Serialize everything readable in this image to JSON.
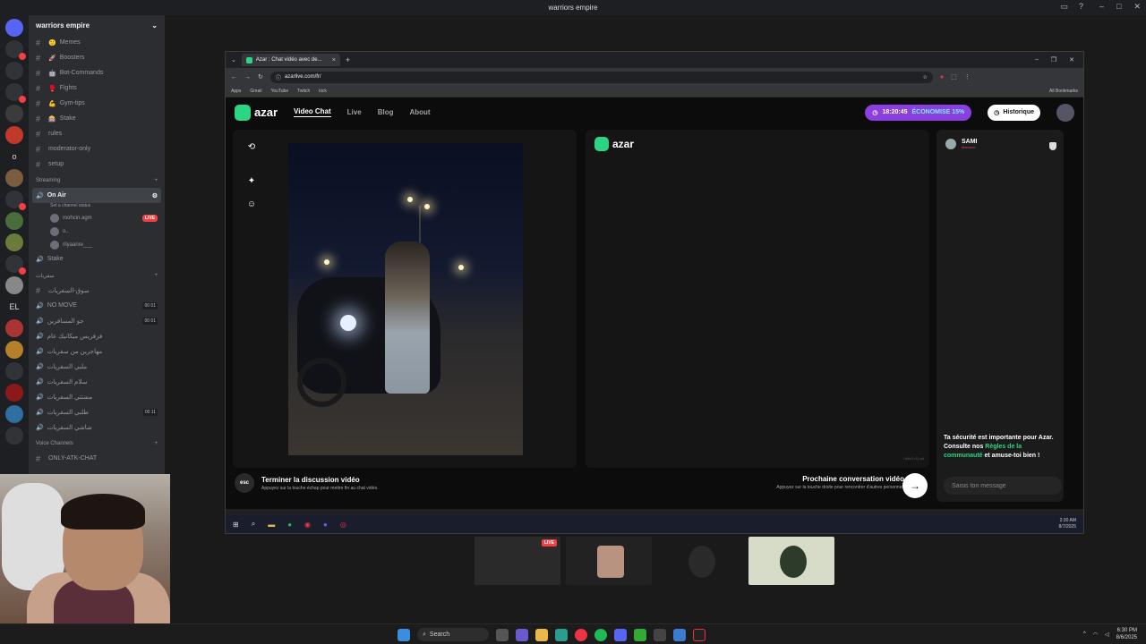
{
  "discord": {
    "window_title": "warriors empire",
    "server_name": "warriors empire",
    "channels": [
      {
        "name": "Memes",
        "emoji": "🙂"
      },
      {
        "name": "Boosters",
        "emoji": "🚀"
      },
      {
        "name": "Bot-Commands",
        "emoji": "🤖"
      },
      {
        "name": "Fights",
        "emoji": "🥊"
      },
      {
        "name": "Gym-tips",
        "emoji": "💪"
      },
      {
        "name": "Stake",
        "emoji": "🎰"
      },
      {
        "name": "rules",
        "emoji": ""
      },
      {
        "name": "moderator-only",
        "emoji": ""
      },
      {
        "name": "setup",
        "emoji": ""
      }
    ],
    "streaming_category": "Streaming",
    "on_air": "On Air",
    "on_air_status": "Set a channel status",
    "on_air_users": [
      {
        "name": "mohcin.agm",
        "live": "LIVE"
      },
      {
        "name": "o..",
        "live": ""
      },
      {
        "name": "rilyaanre___",
        "live": ""
      }
    ],
    "stake_voice": "Stake",
    "arabic_category": "سفريات",
    "arabic_channels": [
      {
        "name": "سوق-السفريات",
        "count": ""
      },
      {
        "name": "NO MOVE",
        "count": "00 01"
      },
      {
        "name": "جو المسافرين",
        "count": "00 01"
      },
      {
        "name": "فرفريس ميكانيك عام",
        "count": ""
      },
      {
        "name": "مهاجرين من سفريات",
        "count": ""
      },
      {
        "name": "ملبي السفريات",
        "count": ""
      },
      {
        "name": "سلام السفريات",
        "count": ""
      },
      {
        "name": "مشتتي السفريات",
        "count": ""
      },
      {
        "name": "طلبي السفريات",
        "count": "00 11"
      },
      {
        "name": "شاشي السفريات",
        "count": ""
      }
    ],
    "voice_category": "Voice Channels",
    "voice_channel": "ONLY-ATK-CHAT"
  },
  "browser": {
    "tab_title": "Azar : Chat vidéo avec de...",
    "url": "azarlive.com/fr/",
    "bookmarks": [
      "Apps",
      "Gmail",
      "YouTube",
      "Twitch",
      "kick"
    ],
    "all_bookmarks": "All Bookmarks"
  },
  "azar": {
    "logo": "azar",
    "nav": [
      "Video Chat",
      "Live",
      "Blog",
      "About"
    ],
    "promo_time": "18:20:45",
    "promo_text": "ÉCONOMISE 15%",
    "history": "Historique",
    "peer_name": "SAMI",
    "peer_country": "Morocco",
    "peer_id": "h86a7c1ji a8",
    "safety_1": "Ta sécurité est importante pour Azar. Consulte nos ",
    "safety_link": "Règles de la communauté",
    "safety_2": " et amuse-toi bien !",
    "end_title": "Terminer la discussion vidéo",
    "end_sub": "Appuyez sur la touche échap pour mettre fin au chat vidéo.",
    "esc": "esc",
    "next_title": "Prochaine conversation vidéo",
    "next_sub": "Appuyez sur la touche droite pour rencontrer d'autres personnes",
    "message_placeholder": "Saisis ton message",
    "inner_time": "2:30 AM",
    "inner_date": "8/7/2025"
  },
  "thumbs": {
    "live": "LIVE"
  },
  "taskbar": {
    "search": "Search",
    "time": "6:30 PM",
    "date": "8/6/2025"
  },
  "colors": {
    "azar_green": "#2dd484",
    "promo": "#8b3fe0",
    "discord_bg": "#2b2d31"
  }
}
